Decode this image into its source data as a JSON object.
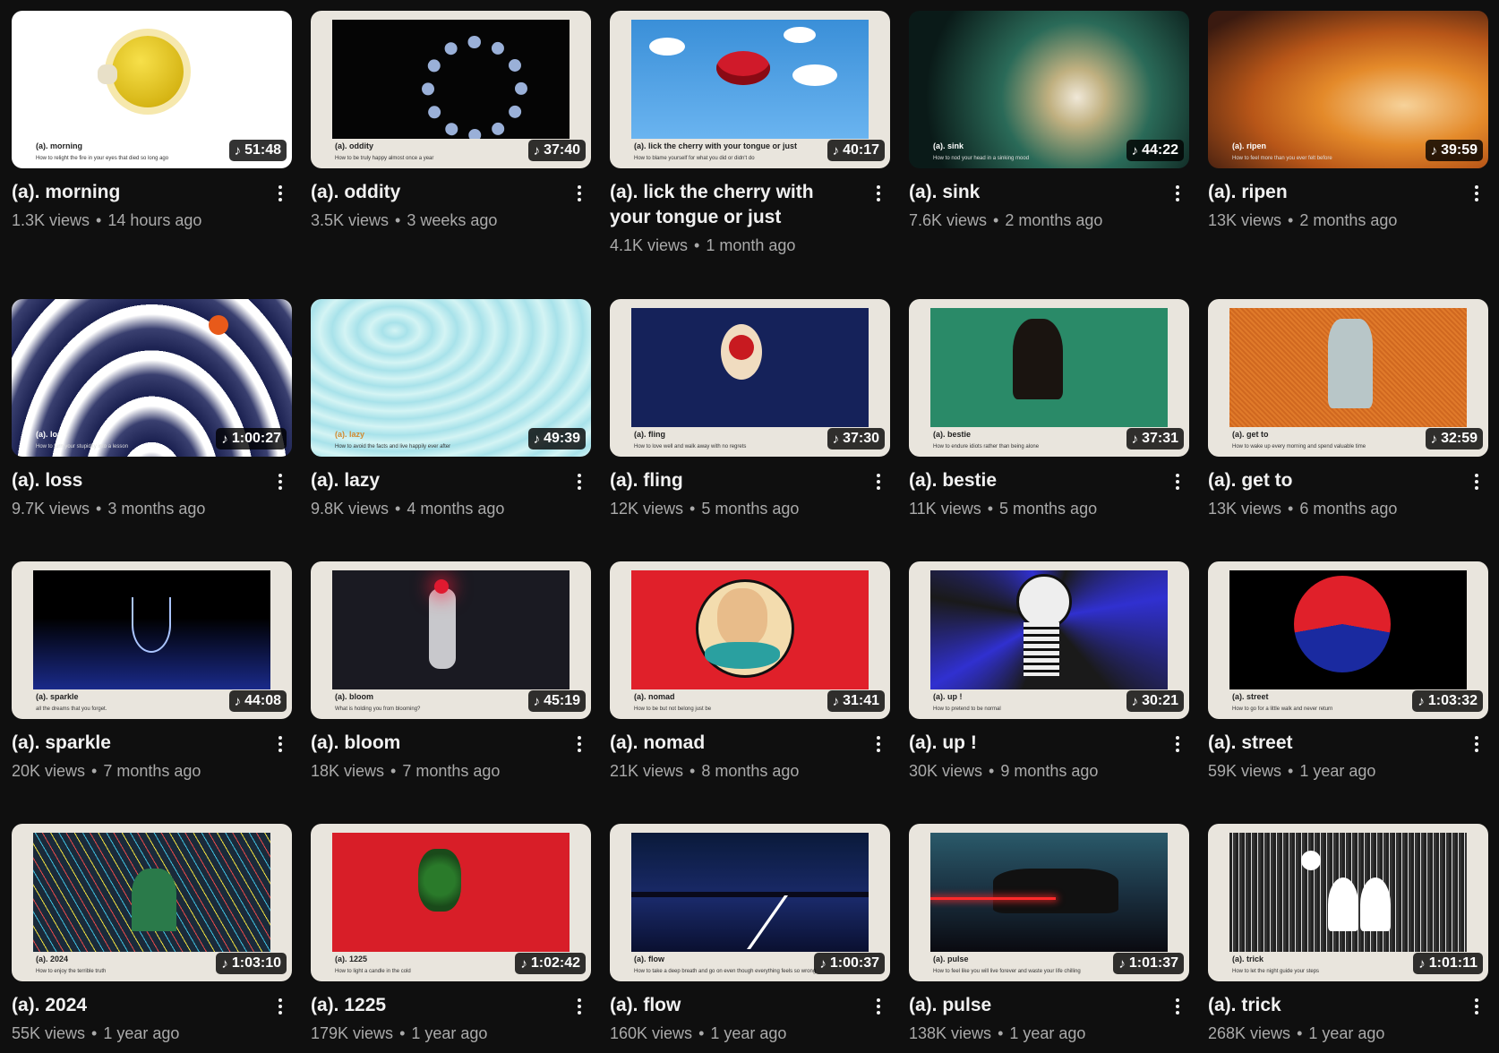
{
  "videos": [
    {
      "title": "(a). morning",
      "views": "1.3K views",
      "age": "14 hours ago",
      "duration": "51:48",
      "cap_title": "(a). morning",
      "cap_sub": "How to relight the fire in your eyes that died so long ago",
      "theme": "morning"
    },
    {
      "title": "(a). oddity",
      "views": "3.5K views",
      "age": "3 weeks ago",
      "duration": "37:40",
      "cap_title": "(a). oddity",
      "cap_sub": "How to be truly happy almost once a year",
      "theme": "oddity"
    },
    {
      "title": "(a). lick the cherry with your tongue or just",
      "views": "4.1K views",
      "age": "1 month ago",
      "duration": "40:17",
      "cap_title": "(a). lick the cherry with your tongue or just",
      "cap_sub": "How to blame yourself for what you did or didn't do",
      "theme": "lick"
    },
    {
      "title": "(a). sink",
      "views": "7.6K views",
      "age": "2 months ago",
      "duration": "44:22",
      "cap_title": "(a). sink",
      "cap_sub": "How to nod your head in a sinking mood",
      "theme": "sink"
    },
    {
      "title": "(a). ripen",
      "views": "13K views",
      "age": "2 months ago",
      "duration": "39:59",
      "cap_title": "(a). ripen",
      "cap_sub": "How to feel more than you ever felt before",
      "theme": "ripen"
    },
    {
      "title": "(a). loss",
      "views": "9.7K views",
      "age": "3 months ago",
      "duration": "1:00:27",
      "cap_title": "(a). loss",
      "cap_sub": "How to turn your stupidity into a lesson",
      "theme": "loss"
    },
    {
      "title": "(a). lazy",
      "views": "9.8K views",
      "age": "4 months ago",
      "duration": "49:39",
      "cap_title": "(a). lazy",
      "cap_sub": "How to avoid the facts and live happily ever after",
      "theme": "lazy"
    },
    {
      "title": "(a). fling",
      "views": "12K views",
      "age": "5 months ago",
      "duration": "37:30",
      "cap_title": "(a). fling",
      "cap_sub": "How to love well and walk away with no regrets",
      "theme": "fling"
    },
    {
      "title": "(a). bestie",
      "views": "11K views",
      "age": "5 months ago",
      "duration": "37:31",
      "cap_title": "(a). bestie",
      "cap_sub": "How to endure idiots rather than being alone",
      "theme": "bestie"
    },
    {
      "title": "(a). get to",
      "views": "13K views",
      "age": "6 months ago",
      "duration": "32:59",
      "cap_title": "(a). get to",
      "cap_sub": "How to wake up every morning and spend valuable time",
      "theme": "getto"
    },
    {
      "title": "(a). sparkle",
      "views": "20K views",
      "age": "7 months ago",
      "duration": "44:08",
      "cap_title": "(a). sparkle",
      "cap_sub": "all the dreams that you forget.",
      "theme": "sparkle"
    },
    {
      "title": "(a). bloom",
      "views": "18K views",
      "age": "7 months ago",
      "duration": "45:19",
      "cap_title": "(a). bloom",
      "cap_sub": "What is holding you from blooming?",
      "theme": "bloom"
    },
    {
      "title": "(a). nomad",
      "views": "21K views",
      "age": "8 months ago",
      "duration": "31:41",
      "cap_title": "(a). nomad",
      "cap_sub": "How to be but not belong just be",
      "theme": "nomad"
    },
    {
      "title": "(a). up !",
      "views": "30K views",
      "age": "9 months ago",
      "duration": "30:21",
      "cap_title": "(a). up !",
      "cap_sub": "How to pretend to be normal",
      "theme": "up"
    },
    {
      "title": "(a). street",
      "views": "59K views",
      "age": "1 year ago",
      "duration": "1:03:32",
      "cap_title": "(a). street",
      "cap_sub": "How to go for a little walk and never return",
      "theme": "street"
    },
    {
      "title": "(a). 2024",
      "views": "55K views",
      "age": "1 year ago",
      "duration": "1:03:10",
      "cap_title": "(a). 2024",
      "cap_sub": "How to enjoy the terrible truth",
      "theme": "y2024"
    },
    {
      "title": "(a). 1225",
      "views": "179K views",
      "age": "1 year ago",
      "duration": "1:02:42",
      "cap_title": "(a). 1225",
      "cap_sub": "How to light a candle in the cold",
      "theme": "x1225"
    },
    {
      "title": "(a). flow",
      "views": "160K views",
      "age": "1 year ago",
      "duration": "1:00:37",
      "cap_title": "(a). flow",
      "cap_sub": "How to take a deep breath and go on even though everything feels so wrong",
      "theme": "flow"
    },
    {
      "title": "(a). pulse",
      "views": "138K views",
      "age": "1 year ago",
      "duration": "1:01:37",
      "cap_title": "(a). pulse",
      "cap_sub": "How to feel like you will live forever and waste your life chilling",
      "theme": "pulse"
    },
    {
      "title": "(a). trick",
      "views": "268K views",
      "age": "1 year ago",
      "duration": "1:01:11",
      "cap_title": "(a). trick",
      "cap_sub": "How to let the night guide your steps",
      "theme": "trick"
    }
  ],
  "icons": {
    "duration": "music-note-icon",
    "menu": "more-vert-icon"
  },
  "separator": "•"
}
